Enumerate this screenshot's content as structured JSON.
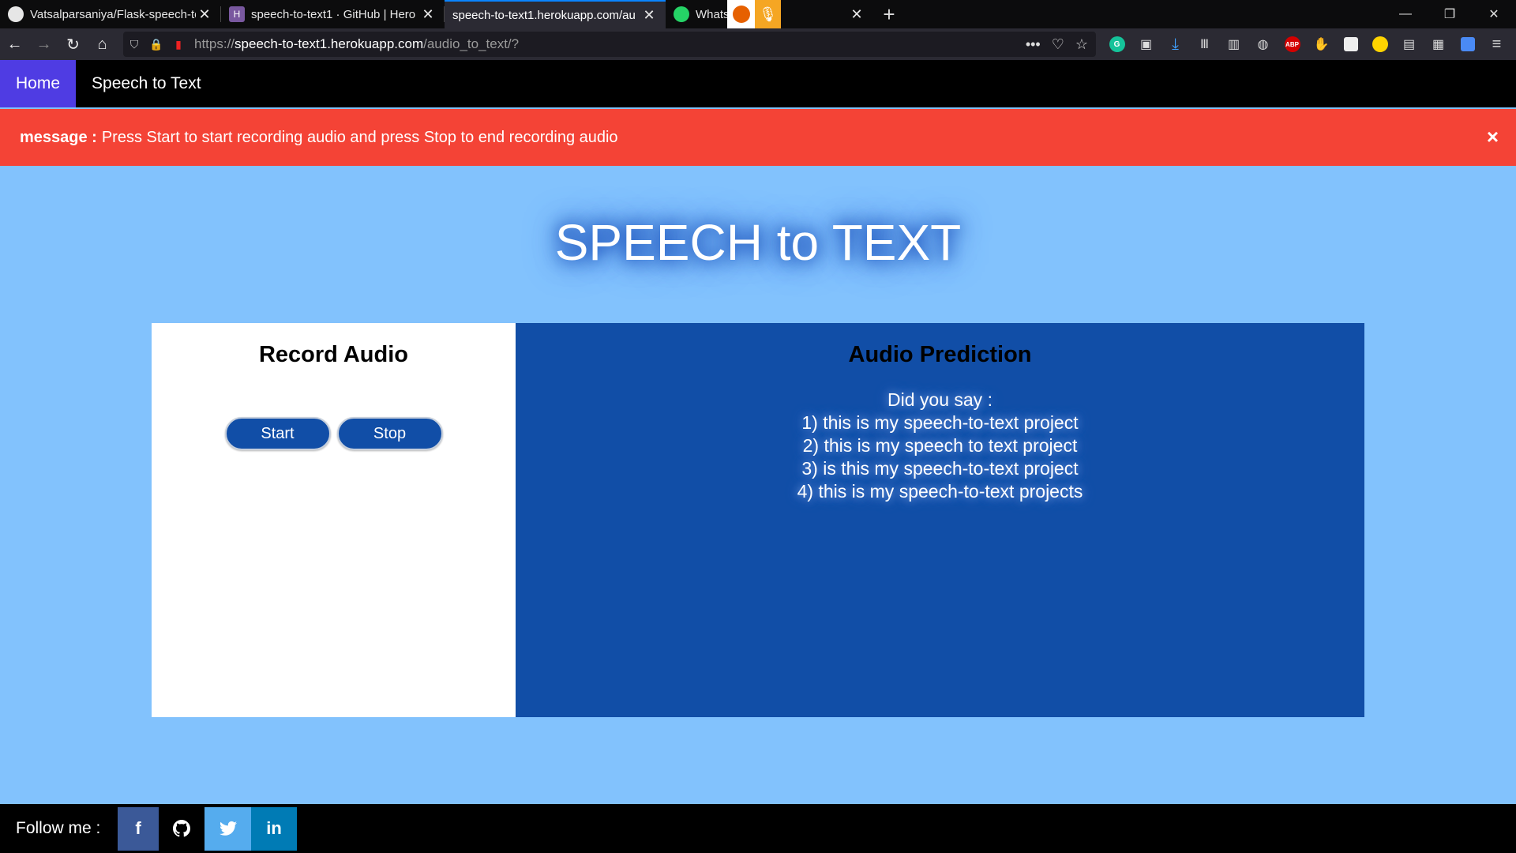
{
  "browser": {
    "tabs": [
      {
        "title": "Vatsalparsaniya/Flask-speech-to",
        "favicon_color": "#e6e6e6",
        "favicon_text": ""
      },
      {
        "title": "speech-to-text1 · GitHub | Hero",
        "favicon_color": "#79589f",
        "favicon_text": "H"
      },
      {
        "title": "speech-to-text1.herokuapp.com/au",
        "favicon_color": "",
        "favicon_text": ""
      },
      {
        "title": "Whats",
        "favicon_color": "#25d366",
        "favicon_text": ""
      }
    ],
    "url_prefix": "https://",
    "url_host": "speech-to-text1.herokuapp.com",
    "url_path": "/audio_to_text/?"
  },
  "site_nav": {
    "home": "Home",
    "speech_to_text": "Speech to Text"
  },
  "alert": {
    "label": "message :",
    "text": "Press Start to start recording audio and press Stop to end recording audio",
    "close": "×"
  },
  "hero": {
    "title": "SPEECH to TEXT"
  },
  "record": {
    "heading": "Record Audio",
    "start": "Start",
    "stop": "Stop"
  },
  "prediction": {
    "heading": "Audio Prediction",
    "intro": "Did you say :",
    "items": [
      "1) this is my speech-to-text project",
      "2) this is my speech to text project",
      "3) is this my speech-to-text project",
      "4) this is my speech-to-text projects"
    ]
  },
  "footer": {
    "label": "Follow me :",
    "facebook": "f",
    "twitter": "🐦",
    "linkedin": "in"
  }
}
